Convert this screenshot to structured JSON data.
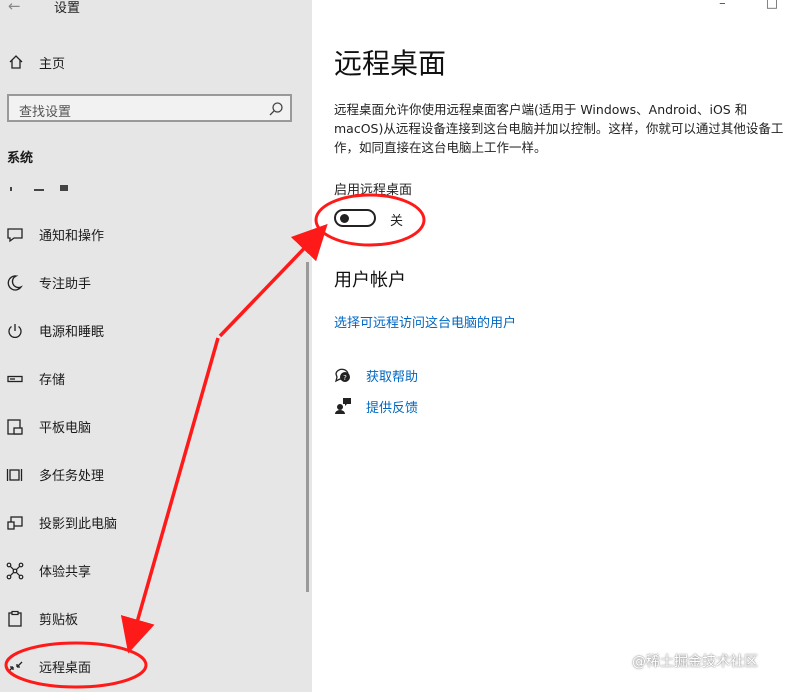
{
  "window": {
    "title": "设置",
    "back_glyph": "←",
    "controls_glyph": "– □"
  },
  "sidebar": {
    "home_label": "主页",
    "search_placeholder": "查找设置",
    "section_title": "系统",
    "items": [
      {
        "label": "通知和操作",
        "icon": "notification-icon"
      },
      {
        "label": "专注助手",
        "icon": "moon-icon"
      },
      {
        "label": "电源和睡眠",
        "icon": "power-icon"
      },
      {
        "label": "存储",
        "icon": "storage-icon"
      },
      {
        "label": "平板电脑",
        "icon": "tablet-icon"
      },
      {
        "label": "多任务处理",
        "icon": "multitask-icon"
      },
      {
        "label": "投影到此电脑",
        "icon": "project-icon"
      },
      {
        "label": "体验共享",
        "icon": "share-icon"
      },
      {
        "label": "剪贴板",
        "icon": "clipboard-icon"
      },
      {
        "label": "远程桌面",
        "icon": "remote-desktop-icon"
      }
    ]
  },
  "main": {
    "title": "远程桌面",
    "description": "远程桌面允许你使用远程桌面客户端(适用于 Windows、Android、iOS 和 macOS)从远程设备连接到这台电脑并加以控制。这样，你就可以通过其他设备工作，如同直接在这台电脑上工作一样。",
    "toggle_label": "启用远程桌面",
    "toggle_state": "关",
    "toggle_on": false,
    "user_accounts_title": "用户帐户",
    "user_accounts_link": "选择可远程访问这台电脑的用户",
    "help_link": "获取帮助",
    "feedback_link": "提供反馈"
  },
  "watermark": "@稀土掘金技术社区",
  "colors": {
    "accent": "#0067c0",
    "annotation": "#ff1a1a",
    "sidebar_bg": "#e6e6e6"
  }
}
